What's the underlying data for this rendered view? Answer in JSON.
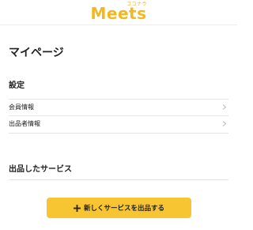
{
  "header": {
    "logo_sub": "ココナラ",
    "logo_text": "Meets"
  },
  "page": {
    "title": "マイページ"
  },
  "settings": {
    "heading": "設定",
    "items": [
      {
        "label": "会員情報",
        "icon": "chevron-right-icon"
      },
      {
        "label": "出品者情報",
        "icon": "chevron-right-icon"
      }
    ]
  },
  "services": {
    "heading": "出品したサービス",
    "cta_label": "新しくサービスを出品する",
    "cta_icon": "plus-icon"
  },
  "colors": {
    "brand": "#f5b81c",
    "cta_background": "#f6c531",
    "divider": "#e4e4e4"
  }
}
